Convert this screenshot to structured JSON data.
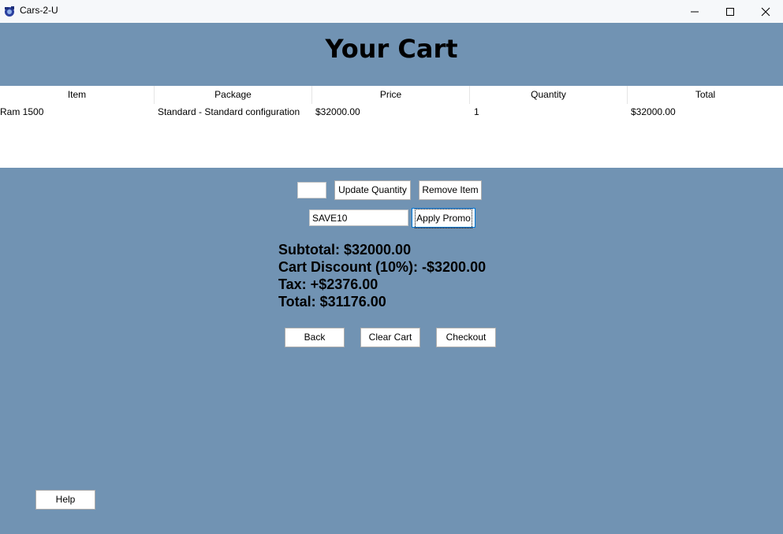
{
  "window": {
    "title": "Cars-2-U",
    "controls": [
      "minimize-icon",
      "maximize-icon",
      "close-icon"
    ]
  },
  "header": {
    "title": "Your Cart"
  },
  "table": {
    "columns": [
      "Item",
      "Package",
      "Price",
      "Quantity",
      "Total"
    ],
    "rows": [
      {
        "item": "Ram 1500",
        "package": "Standard - Standard configuration",
        "price": "$32000.00",
        "quantity": "1",
        "total": "$32000.00"
      }
    ]
  },
  "controls": {
    "quantity_value": "",
    "update_quantity_label": "Update Quantity",
    "remove_item_label": "Remove Item",
    "promo_value": "SAVE10",
    "apply_promo_label": "Apply Promo"
  },
  "summary": {
    "subtotal": "Subtotal: $32000.00",
    "discount": "Cart Discount (10%): -$3200.00",
    "tax": "Tax: +$2376.00",
    "total": "Total: $31176.00"
  },
  "actions": {
    "back_label": "Back",
    "clear_cart_label": "Clear Cart",
    "checkout_label": "Checkout",
    "help_label": "Help"
  },
  "colors": {
    "background": "#7193b3",
    "titlebar": "#f6f8fa",
    "table_bg": "#ffffff"
  }
}
